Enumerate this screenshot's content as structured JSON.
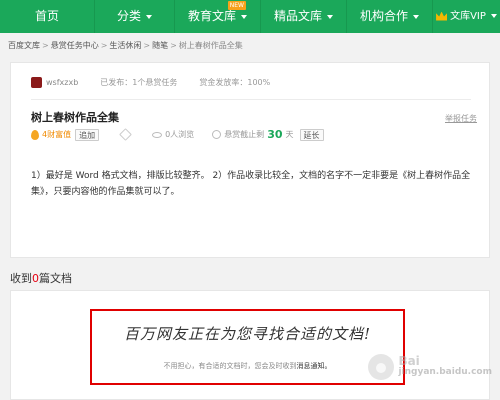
{
  "nav": {
    "items": [
      {
        "label": "首页"
      },
      {
        "label": "分类"
      },
      {
        "label": "教育文库",
        "badge": "NEW"
      },
      {
        "label": "精品文库"
      },
      {
        "label": "机构合作"
      },
      {
        "label": "文库VIP"
      }
    ]
  },
  "breadcrumb": {
    "items": [
      "百度文库",
      "悬赏任务中心",
      "生活休闲",
      "随笔",
      "树上春树作品全集"
    ],
    "separator": ">"
  },
  "task": {
    "username": "wsfxzxb",
    "published": "已发布：1个悬赏任务",
    "adoption_rate": "赏金发放率：100%",
    "title": "树上春树作品全集",
    "report_label": "举报任务",
    "reward": "4财富值",
    "add_label": "追加",
    "views": "0人浏览",
    "deadline_label": "悬赏截止剩",
    "days": "30",
    "days_unit": "天",
    "extend_label": "延长",
    "description": "1）最好是 Word 格式文档，排版比较整齐。 2）作品收录比较全，文档的名字不一定非要是《树上春树作品全集》，只要内容他的作品集就可以了。"
  },
  "received": {
    "prefix": "收到",
    "count": "0",
    "suffix": "篇文档"
  },
  "notice": {
    "title": "百万网友正在为您寻找合适的文档!",
    "sub_text": "不用担心，有合适的文档时，您会及时收到",
    "sub_link": "消息通知。"
  },
  "watermark": {
    "line1": "Bai",
    "line2": "jingyan.baidu.com"
  },
  "colors": {
    "nav_bg": "#1ba85a",
    "accent_green": "#1ba85a",
    "reward_orange": "#f08a00",
    "zero_red": "#e60012",
    "highlight_border": "#e00000"
  }
}
